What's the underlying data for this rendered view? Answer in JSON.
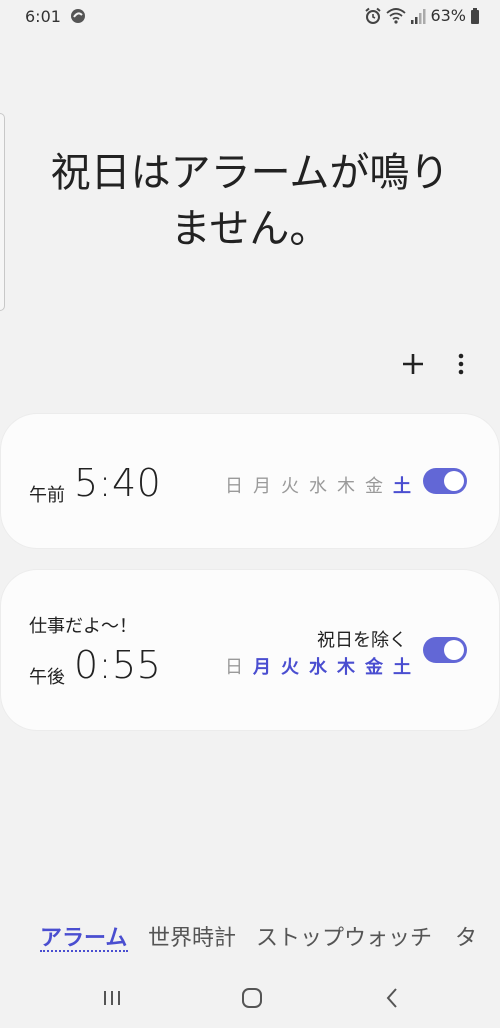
{
  "status_bar": {
    "time": "6:01",
    "battery": "63%",
    "icons": [
      "app-icon",
      "alarm-icon",
      "wifi-icon",
      "signal-icon",
      "battery-icon"
    ]
  },
  "notice": {
    "line1": "祝日はアラームが鳴り",
    "line2": "ません。"
  },
  "toolbar": {
    "icons": [
      "plus-icon",
      "more-vert-icon"
    ]
  },
  "alarms": [
    {
      "ampm": "午前",
      "time": "5:40",
      "label": "",
      "note": "",
      "days": [
        {
          "label": "日",
          "active": false
        },
        {
          "label": "月",
          "active": false
        },
        {
          "label": "火",
          "active": false
        },
        {
          "label": "水",
          "active": false
        },
        {
          "label": "木",
          "active": false
        },
        {
          "label": "金",
          "active": false
        },
        {
          "label": "土",
          "active": true
        }
      ],
      "enabled": true
    },
    {
      "ampm": "午後",
      "time": "0:55",
      "label": "仕事だよ～！",
      "note": "祝日を除く",
      "days": [
        {
          "label": "日",
          "active": false
        },
        {
          "label": "月",
          "active": true
        },
        {
          "label": "火",
          "active": true
        },
        {
          "label": "水",
          "active": true
        },
        {
          "label": "木",
          "active": true
        },
        {
          "label": "金",
          "active": true
        },
        {
          "label": "土",
          "active": true
        }
      ],
      "enabled": true
    }
  ],
  "tabs": [
    {
      "label": "アラーム",
      "active": true
    },
    {
      "label": "世界時計",
      "active": false
    },
    {
      "label": "ストップウォッチ",
      "active": false
    },
    {
      "label": "タ",
      "active": false
    }
  ],
  "nav": {
    "icons": [
      "recent-apps-icon",
      "home-icon",
      "back-icon"
    ]
  },
  "colors": {
    "accent": "#4a4ed0",
    "toggle": "#6267d6",
    "background": "#f2f2f2",
    "card": "#fcfcfc"
  }
}
